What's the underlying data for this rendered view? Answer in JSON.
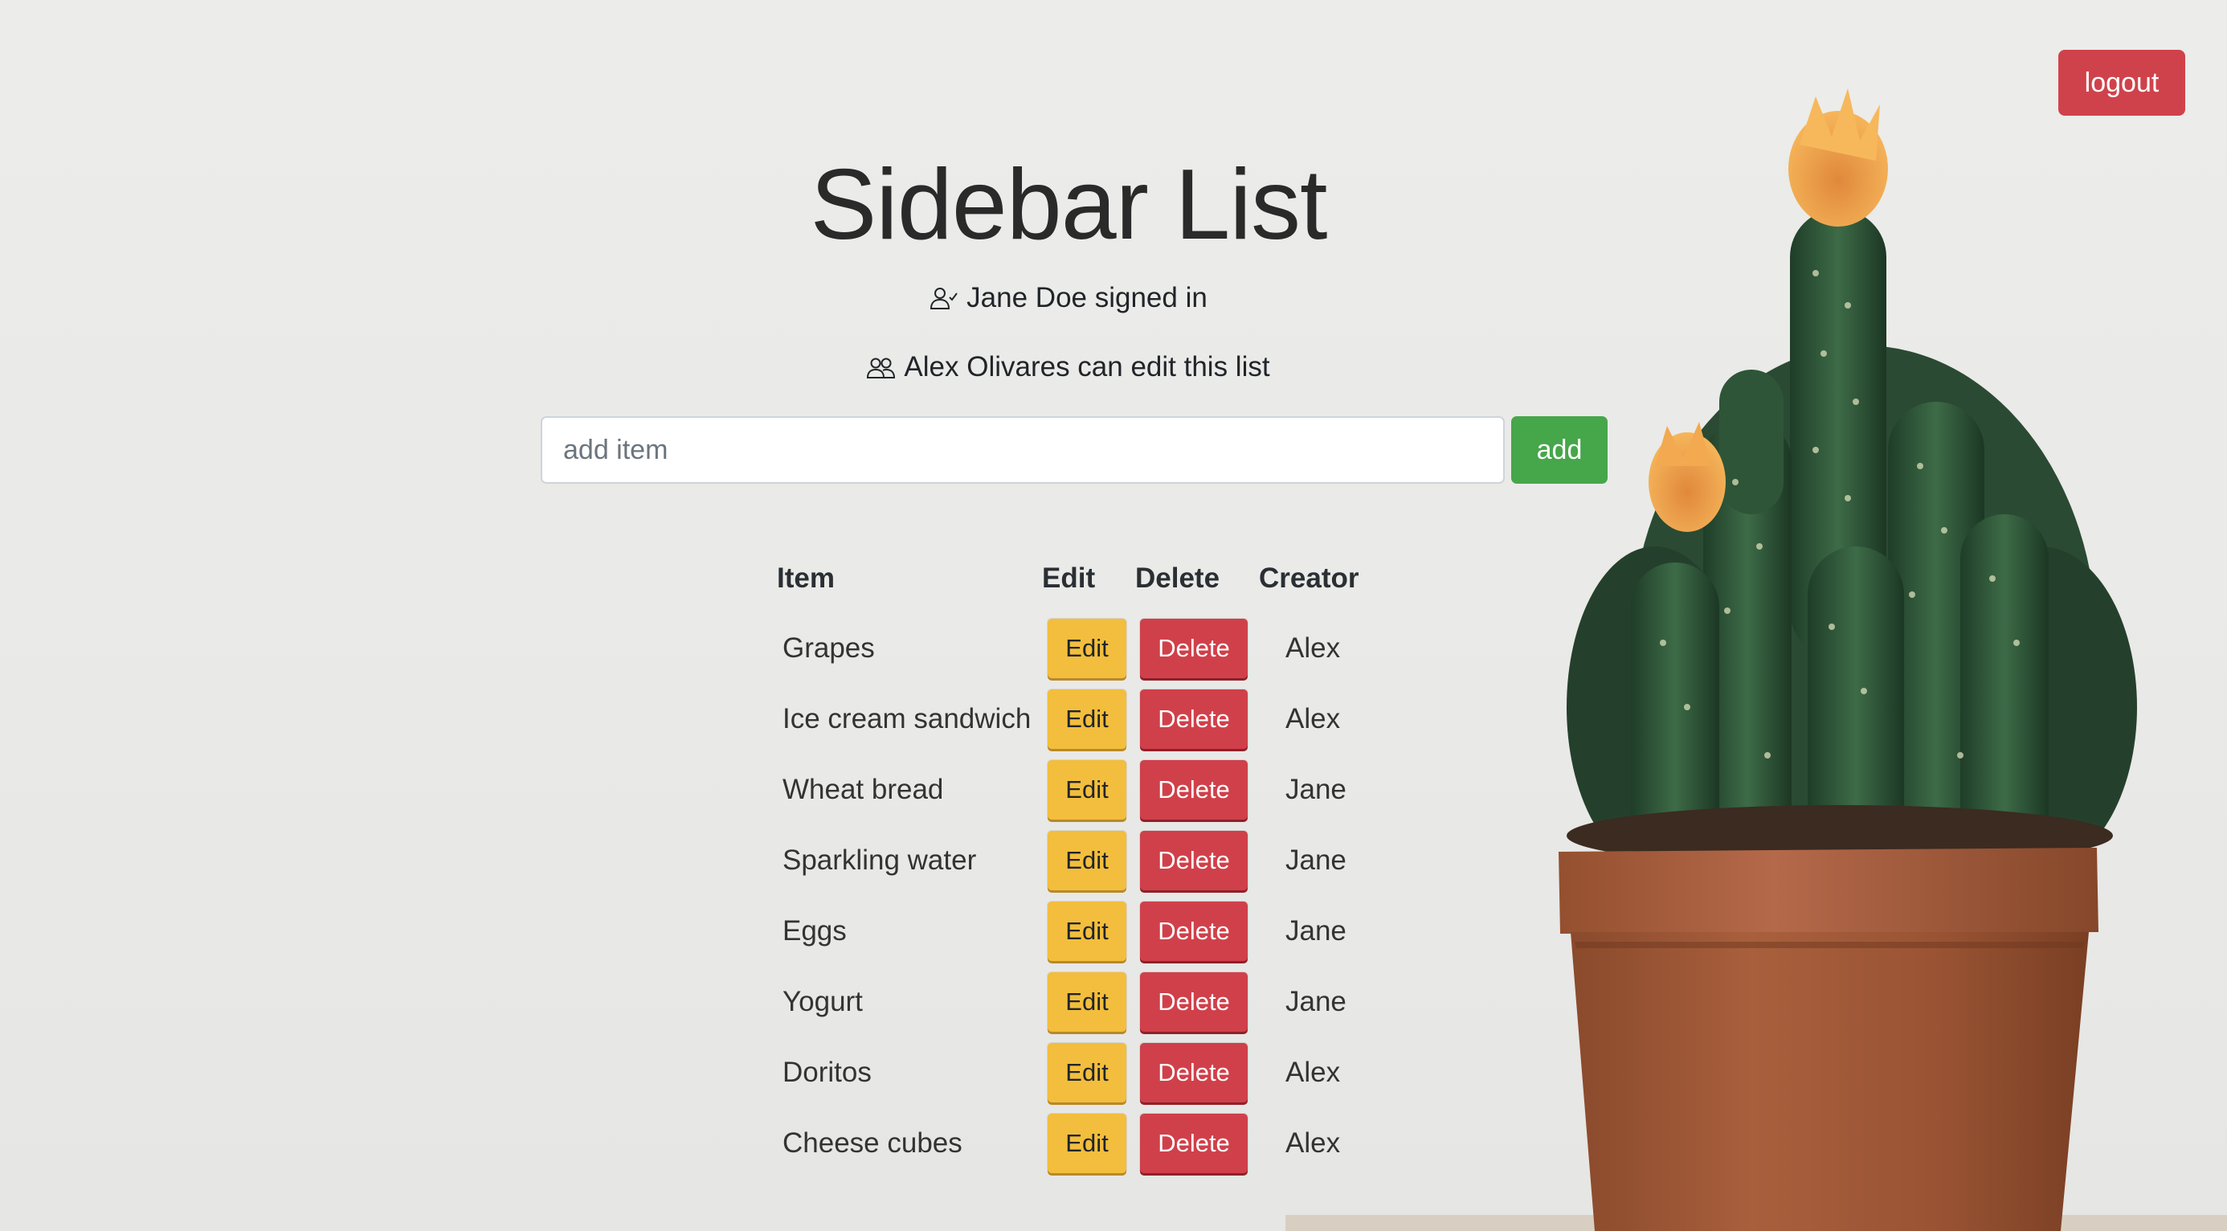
{
  "header": {
    "logout_label": "logout",
    "title": "Sidebar List",
    "signed_in_text": "Jane Doe signed in",
    "editors_text": "Alex Olivares can edit this list"
  },
  "add_form": {
    "placeholder": "add item",
    "value": "",
    "add_label": "add"
  },
  "table": {
    "columns": [
      "Item",
      "Edit",
      "Delete",
      "Creator"
    ],
    "edit_label": "Edit",
    "delete_label": "Delete",
    "rows": [
      {
        "item": "Grapes",
        "creator": "Alex"
      },
      {
        "item": "Ice cream sandwich",
        "creator": "Alex"
      },
      {
        "item": "Wheat bread",
        "creator": "Jane"
      },
      {
        "item": "Sparkling water",
        "creator": "Jane"
      },
      {
        "item": "Eggs",
        "creator": "Jane"
      },
      {
        "item": "Yogurt",
        "creator": "Jane"
      },
      {
        "item": "Doritos",
        "creator": "Alex"
      },
      {
        "item": "Cheese cubes",
        "creator": "Alex"
      }
    ]
  },
  "icons": {
    "signed_in": "user-check-icon",
    "editors": "people-icon"
  },
  "colors": {
    "logout": "#d0424b",
    "add": "#46a64a",
    "edit": "#f3be3d",
    "delete": "#d0404a",
    "background": "#ebebe9"
  }
}
